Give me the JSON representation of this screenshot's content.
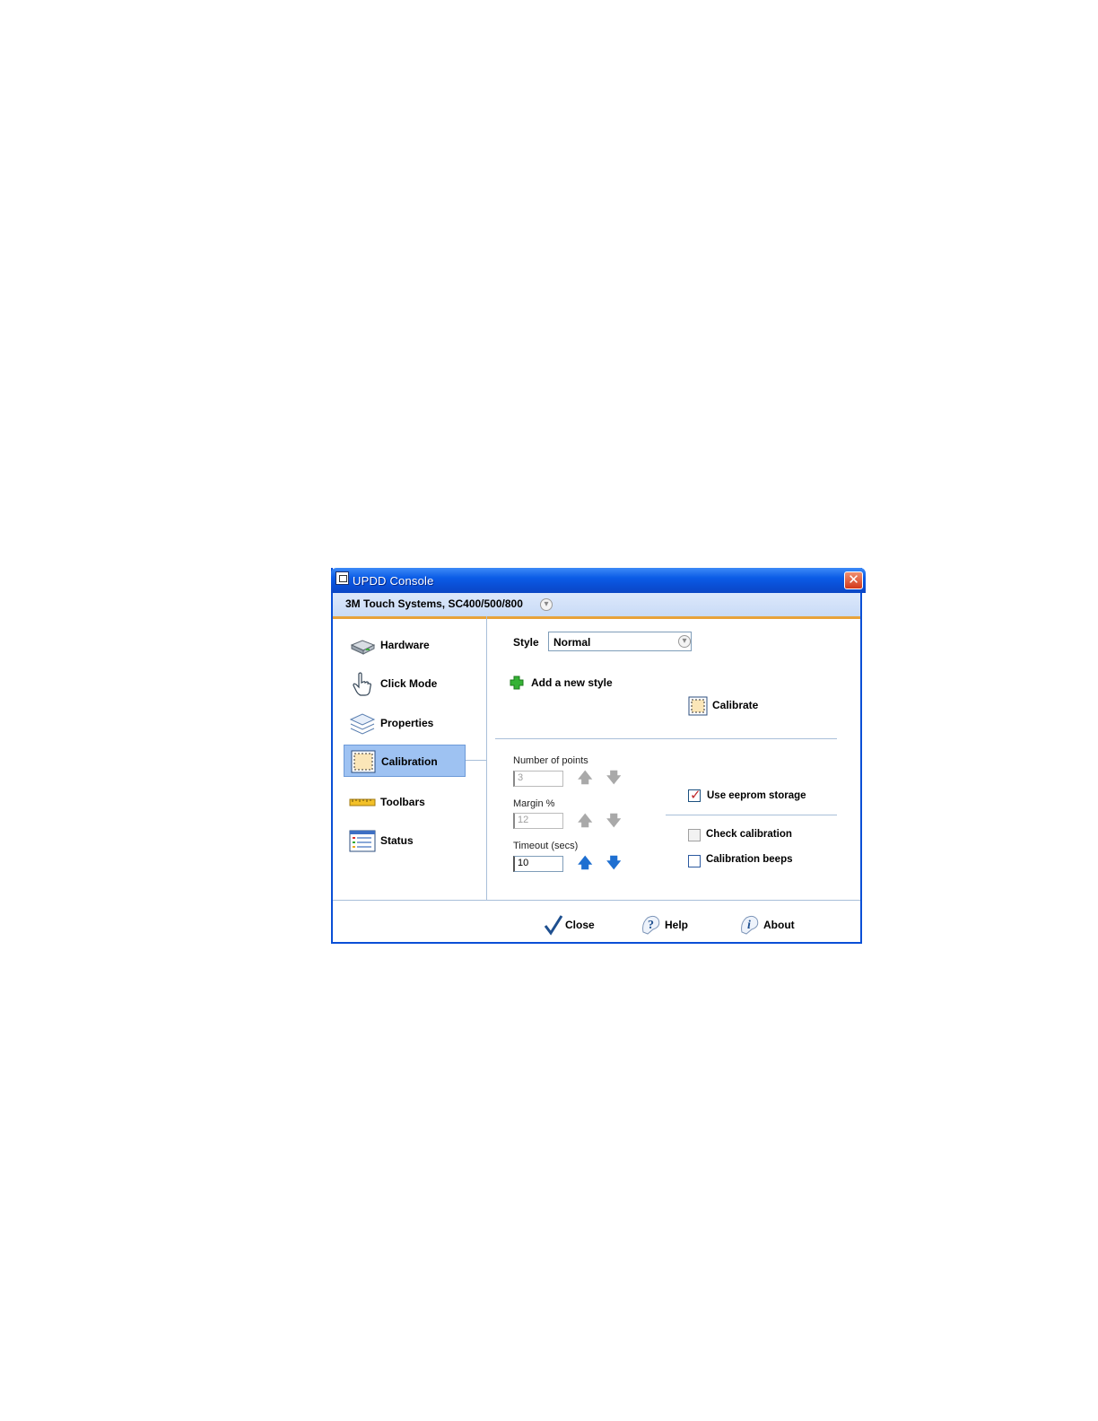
{
  "window": {
    "title": "UPDD Console",
    "close_symbol": "✕"
  },
  "device": {
    "name": "3M Touch Systems, SC400/500/800",
    "icon": "chevron-down-icon"
  },
  "sidebar": {
    "items": [
      {
        "label": "Hardware",
        "icon": "hardware-icon"
      },
      {
        "label": "Click Mode",
        "icon": "hand-pointer-icon"
      },
      {
        "label": "Properties",
        "icon": "layers-icon"
      },
      {
        "label": "Calibration",
        "icon": "calibration-icon",
        "active": true
      },
      {
        "label": "Toolbars",
        "icon": "ruler-icon"
      },
      {
        "label": "Status",
        "icon": "status-list-icon"
      }
    ]
  },
  "main": {
    "style_label": "Style",
    "style_value": "Normal",
    "add_style_label": "Add a new style",
    "calibrate_label": "Calibrate",
    "number_of_points": {
      "label": "Number of points",
      "value": "3",
      "enabled": false
    },
    "margin": {
      "label": "Margin %",
      "value": "12",
      "enabled": false
    },
    "timeout": {
      "label": "Timeout (secs)",
      "value": "10",
      "enabled": true
    },
    "use_eeprom": {
      "label": "Use eeprom storage",
      "checked": true
    },
    "check_calibration": {
      "label": "Check calibration",
      "checked": false,
      "enabled": false
    },
    "calibration_beeps": {
      "label": "Calibration beeps",
      "checked": false
    }
  },
  "footer": {
    "close_label": "Close",
    "help_label": "Help",
    "about_label": "About"
  },
  "colors": {
    "titlebar": "#0a4fd6",
    "accent_orange": "#e8a23a",
    "selection": "#9ec2f2",
    "check_red": "#c0282a"
  }
}
